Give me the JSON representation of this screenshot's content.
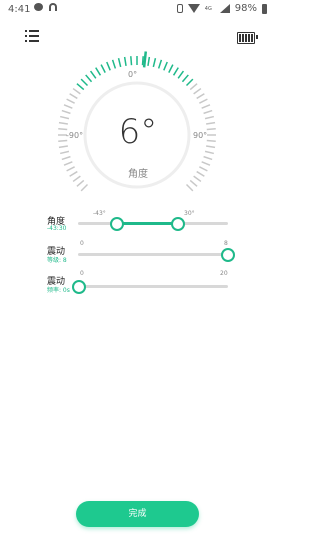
{
  "status_bar": {
    "time": "4:41",
    "battery_percent": "98%",
    "network": "4G"
  },
  "dial": {
    "value": "6°",
    "caption": "角度",
    "label_min": "-90°",
    "label_zero": "0°",
    "label_max": "90°",
    "current_angle": 6,
    "min_angle": -90,
    "max_angle": 90,
    "accent_color": "#1fb98a"
  },
  "settings": {
    "angle": {
      "title": "角度",
      "subtitle": "-43:30",
      "low_label": "-43°",
      "high_label": "30°",
      "low_value": -43,
      "high_value": 30,
      "min": -90,
      "max": 90
    },
    "vibration": {
      "title": "震动",
      "subtitle": "等级: 8",
      "min_label": "0",
      "max_label": "8",
      "value": 8,
      "min": 0,
      "max": 8
    },
    "interval": {
      "title": "震动",
      "subtitle": "频率: 0s",
      "min_label": "0",
      "max_label": "20",
      "value": 0,
      "min": 0,
      "max": 20
    }
  },
  "done_button": {
    "label": "完成",
    "color": "#1ec98f"
  }
}
